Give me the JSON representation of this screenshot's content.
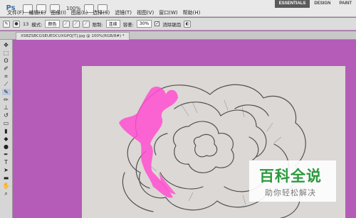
{
  "app": {
    "logo": "Ps"
  },
  "toolbar": {
    "zoom": "100%"
  },
  "menu": [
    "文件(F)",
    "编辑(E)",
    "图像(I)",
    "图层(L)",
    "选择(S)",
    "滤镜(T)",
    "视图(V)",
    "窗口(W)",
    "帮助(H)"
  ],
  "workspaces": {
    "active": "ESSENTIALS",
    "other": "DESIGN",
    "more": "PAINT"
  },
  "options": {
    "mode_label": "模式:",
    "mode_value": "颜色",
    "limits_label": "限制:",
    "limits_value": "连续",
    "tolerance_label": "容差:",
    "tolerance_value": "30%",
    "antialias_label": "消除锯齿",
    "brush_size": "13"
  },
  "document": {
    "tab": "XSBZSBCGSEUEOCUXGPQ[T].jpg @ 100%(RGB/8#) *"
  },
  "tools": [
    "move",
    "marquee",
    "lasso",
    "quick-select",
    "crop",
    "eyedropper",
    "healing",
    "brush",
    "clone",
    "history",
    "eraser",
    "gradient",
    "blur",
    "dodge",
    "pen",
    "text",
    "path-select",
    "shape",
    "hand",
    "zoom"
  ],
  "watermark": {
    "title": "百科全说",
    "subtitle": "助你轻松解决"
  },
  "colors": {
    "canvas_bg": "#b45cb8",
    "highlight": "#ff4fd0",
    "watermark_green": "#2a9a3e"
  }
}
